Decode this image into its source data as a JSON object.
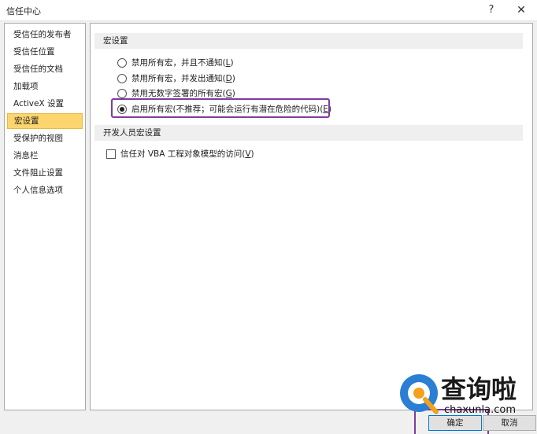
{
  "window": {
    "title": "信任中心",
    "help_glyph": "?",
    "close_glyph": "✕"
  },
  "nav": {
    "items": [
      {
        "label": "受信任的发布者"
      },
      {
        "label": "受信任位置"
      },
      {
        "label": "受信任的文档"
      },
      {
        "label": "加载项"
      },
      {
        "label": "ActiveX 设置"
      },
      {
        "label": "宏设置",
        "selected": true
      },
      {
        "label": "受保护的视图"
      },
      {
        "label": "消息栏"
      },
      {
        "label": "文件阻止设置"
      },
      {
        "label": "个人信息选项"
      }
    ]
  },
  "macro_settings": {
    "header": "宏设置",
    "options": [
      {
        "text": "禁用所有宏，并且不通知(",
        "key": "L",
        "end": ")"
      },
      {
        "text": "禁用所有宏，并发出通知(",
        "key": "D",
        "end": ")"
      },
      {
        "text": "禁用无数字签署的所有宏(",
        "key": "G",
        "end": ")"
      },
      {
        "text": "启用所有宏(不推荐；可能会运行有潜在危险的代码)(",
        "key": "E",
        "end": ")"
      }
    ]
  },
  "developer": {
    "header": "开发人员宏设置",
    "checkbox": {
      "text": "信任对 VBA 工程对象模型的访问(",
      "key": "V",
      "end": ")"
    }
  },
  "buttons": {
    "ok": "确定",
    "cancel": "取消"
  },
  "watermark": {
    "brand": "查询啦",
    "url": "chaxunla.com"
  },
  "colors": {
    "selected_nav": "#fcd56f",
    "annotation": "#7f3b9e",
    "ok_border": "#0078d7"
  }
}
